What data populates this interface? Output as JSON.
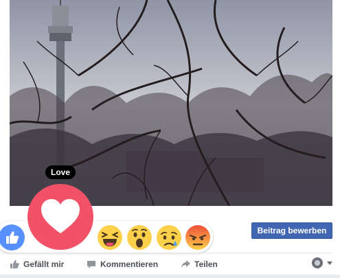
{
  "tooltip": {
    "label": "Love"
  },
  "promote_button": {
    "label": "Beitrag bewerben"
  },
  "reactions": [
    "like",
    "love",
    "haha",
    "wow",
    "sad",
    "angry"
  ],
  "actions": {
    "like_label": "Gefällt mir",
    "comment_label": "Kommentieren",
    "share_label": "Teilen"
  },
  "colors": {
    "brand": "#4267b2",
    "love": "#f25268",
    "like": "#5890ff",
    "emoji_yellow": "#fcd04a",
    "angry_top": "#f04d3a"
  }
}
